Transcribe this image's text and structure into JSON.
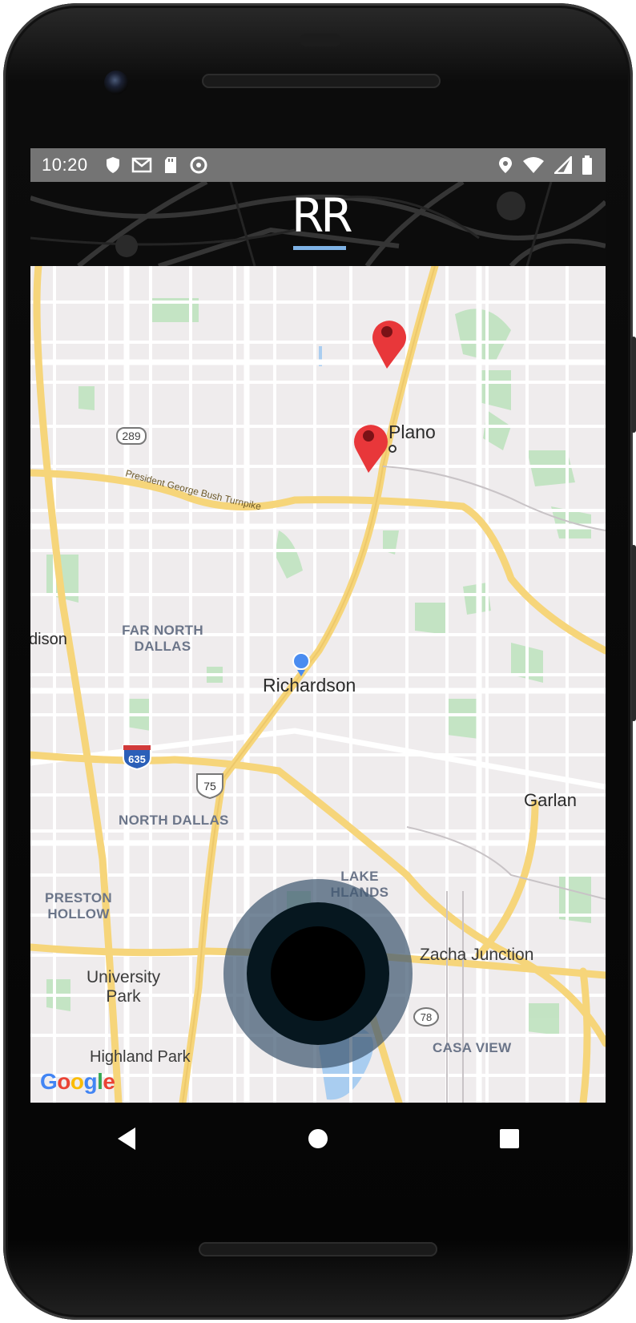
{
  "status_bar": {
    "time": "10:20",
    "left_icons": [
      "shield-icon",
      "mail-icon",
      "sd-card-icon",
      "sync-icon"
    ],
    "right_icons": [
      "location-icon",
      "wifi-icon",
      "signal-icon",
      "battery-icon"
    ]
  },
  "header": {
    "logo_text": "RR",
    "accent_color": "#7fb3e6"
  },
  "map": {
    "labels": {
      "plano": "Plano",
      "addison": "dison",
      "far_north_dallas_1": "FAR NORTH",
      "far_north_dallas_2": "DALLAS",
      "richardson": "Richardson",
      "north_dallas": "NORTH DALLAS",
      "lake_highlands_1": "LAKE",
      "lake_highlands_2": "HLANDS",
      "preston_hollow_1": "PRESTON",
      "preston_hollow_2": "HOLLOW",
      "zacha_junction": "Zacha Junction",
      "university_park_1": "University",
      "university_park_2": "Park",
      "highland_park": "Highland Park",
      "garland": "Garlan",
      "casa_view": "CASA VIEW",
      "turnpike": "President George Bush Turnpike"
    },
    "shields": {
      "r289": "289",
      "i635": "635",
      "us75": "75",
      "r78": "78"
    },
    "markers": [
      "marker-north",
      "marker-plano"
    ],
    "attribution": "Google"
  },
  "joystick": {
    "outer_color": "#405972",
    "inner_color": "#000000"
  },
  "nav": {
    "back": "back-icon",
    "home": "home-icon",
    "recents": "recents-icon"
  }
}
